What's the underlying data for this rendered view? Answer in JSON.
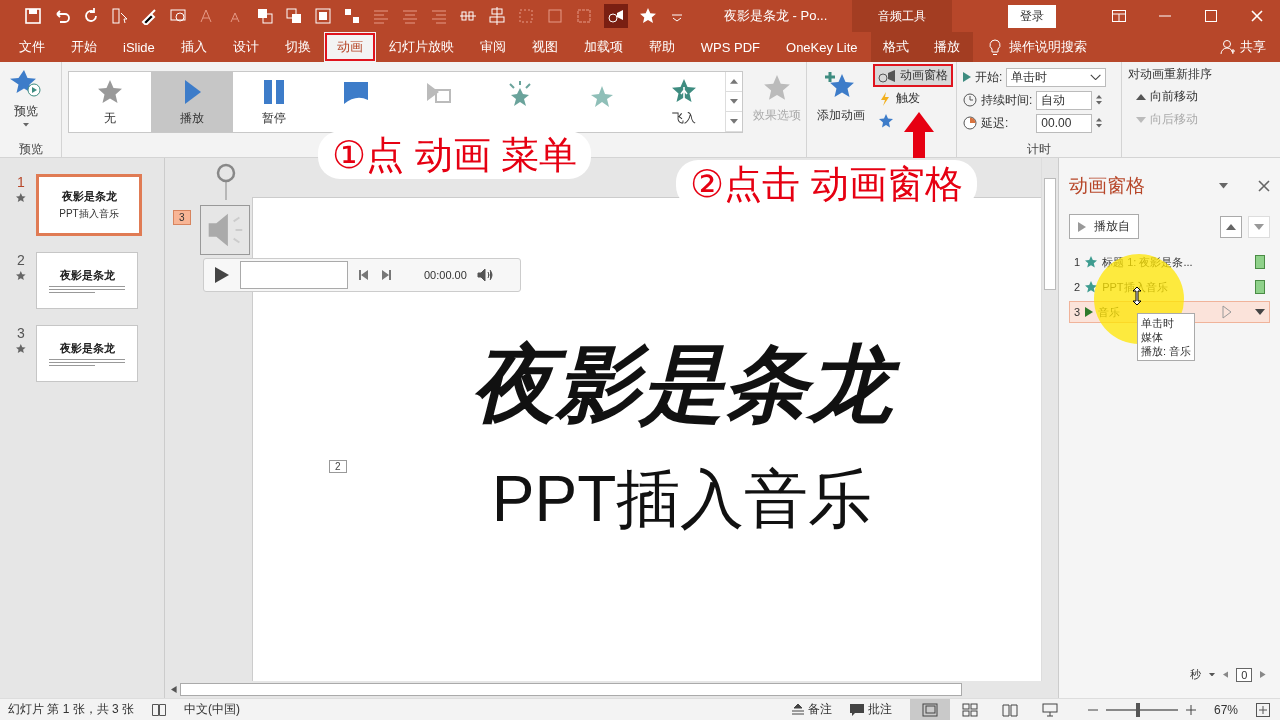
{
  "title_bar": {
    "title": "夜影是条龙  -  Po...",
    "context_group": "音频工具",
    "sign_in": "登录"
  },
  "menu_tabs": [
    {
      "label": "文件",
      "selected": false,
      "highlighted": false,
      "contextual": false
    },
    {
      "label": "开始",
      "selected": false,
      "highlighted": false,
      "contextual": false
    },
    {
      "label": "iSlide",
      "selected": false,
      "highlighted": false,
      "contextual": false
    },
    {
      "label": "插入",
      "selected": false,
      "highlighted": false,
      "contextual": false
    },
    {
      "label": "设计",
      "selected": false,
      "highlighted": false,
      "contextual": false
    },
    {
      "label": "切换",
      "selected": false,
      "highlighted": false,
      "contextual": false
    },
    {
      "label": "动画",
      "selected": true,
      "highlighted": true,
      "contextual": false
    },
    {
      "label": "幻灯片放映",
      "selected": false,
      "highlighted": false,
      "contextual": false
    },
    {
      "label": "审阅",
      "selected": false,
      "highlighted": false,
      "contextual": false
    },
    {
      "label": "视图",
      "selected": false,
      "highlighted": false,
      "contextual": false
    },
    {
      "label": "加载项",
      "selected": false,
      "highlighted": false,
      "contextual": false
    },
    {
      "label": "帮助",
      "selected": false,
      "highlighted": false,
      "contextual": false
    },
    {
      "label": "WPS PDF",
      "selected": false,
      "highlighted": false,
      "contextual": false
    },
    {
      "label": "OneKey Lite",
      "selected": false,
      "highlighted": false,
      "contextual": false
    },
    {
      "label": "格式",
      "selected": false,
      "highlighted": false,
      "contextual": true
    },
    {
      "label": "播放",
      "selected": false,
      "highlighted": false,
      "contextual": true
    }
  ],
  "tell_me": "操作说明搜索",
  "share": "共享",
  "ribbon": {
    "preview": {
      "label": "预览",
      "group": "预览"
    },
    "gallery": [
      {
        "kind": "star",
        "label": "无",
        "selected": false
      },
      {
        "kind": "play",
        "label": "播放",
        "selected": true
      },
      {
        "kind": "pause",
        "label": "暂停",
        "selected": false
      },
      {
        "kind": "shape",
        "selected": false
      },
      {
        "kind": "media",
        "selected": false
      },
      {
        "kind": "burst",
        "selected": false
      },
      {
        "kind": "spark",
        "selected": false
      },
      {
        "kind": "fly",
        "label": "飞入",
        "selected": false
      }
    ],
    "effect_options": {
      "label": "效果选项",
      "disabled": true
    },
    "add_animation": "添加动画",
    "advanced": [
      {
        "kind": "pane",
        "label": "动画窗格",
        "highlighted": true
      },
      {
        "kind": "trigger",
        "label": "触发",
        "highlighted": false
      },
      {
        "kind": "painter",
        "highlighted": false
      }
    ],
    "timing": {
      "group": "计时",
      "start_label": "开始:",
      "start_value": "单击时",
      "duration_label": "持续时间:",
      "duration_value": "自动",
      "delay_label": "延迟:",
      "delay_value": "00.00"
    },
    "reorder": {
      "title": "对动画重新排序",
      "forward": {
        "label": "向前移动",
        "disabled": false
      },
      "backward": {
        "label": "向后移动",
        "disabled": true
      }
    }
  },
  "slides": [
    {
      "number": "1",
      "selected": true,
      "title": "夜影是条龙",
      "subtitle": "PPT插入音乐"
    },
    {
      "number": "2",
      "selected": false,
      "title": "夜影是条龙"
    },
    {
      "number": "3",
      "selected": false,
      "title": "夜影是条龙"
    }
  ],
  "slide": {
    "title": "夜影是条龙",
    "subtitle": "PPT插入音乐",
    "audio_tag": "3",
    "subtitle_tag": "2",
    "player_time": "00:00.00"
  },
  "animation_pane": {
    "title": "动画窗格",
    "play_from": "播放自",
    "items": [
      {
        "number": "1",
        "kind": "effect",
        "label": "标题 1: 夜影是条...",
        "selected": false
      },
      {
        "number": "2",
        "kind": "effect",
        "label": "PPT插入音乐",
        "selected": false
      },
      {
        "number": "3",
        "kind": "media",
        "label": "音乐",
        "selected": true
      }
    ],
    "tooltip": [
      "单击时",
      "媒体",
      "播放: 音乐"
    ],
    "seconds": "秒",
    "timeline": "0"
  },
  "annotations": [
    {
      "text": "①点 动画 菜单"
    },
    {
      "text": "②点击 动画窗格"
    }
  ],
  "status_bar": {
    "slide_info": "幻灯片 第 1 张，共 3 张",
    "language": "中文(中国)",
    "notes": "备注",
    "comments": "批注",
    "views": [
      {
        "kind": "normal",
        "selected": true
      },
      {
        "kind": "sorter",
        "selected": false
      },
      {
        "kind": "reading",
        "selected": false
      },
      {
        "kind": "show",
        "selected": false
      }
    ],
    "zoom_slider": {
      "level": 0.45
    },
    "zoom": "67%"
  }
}
